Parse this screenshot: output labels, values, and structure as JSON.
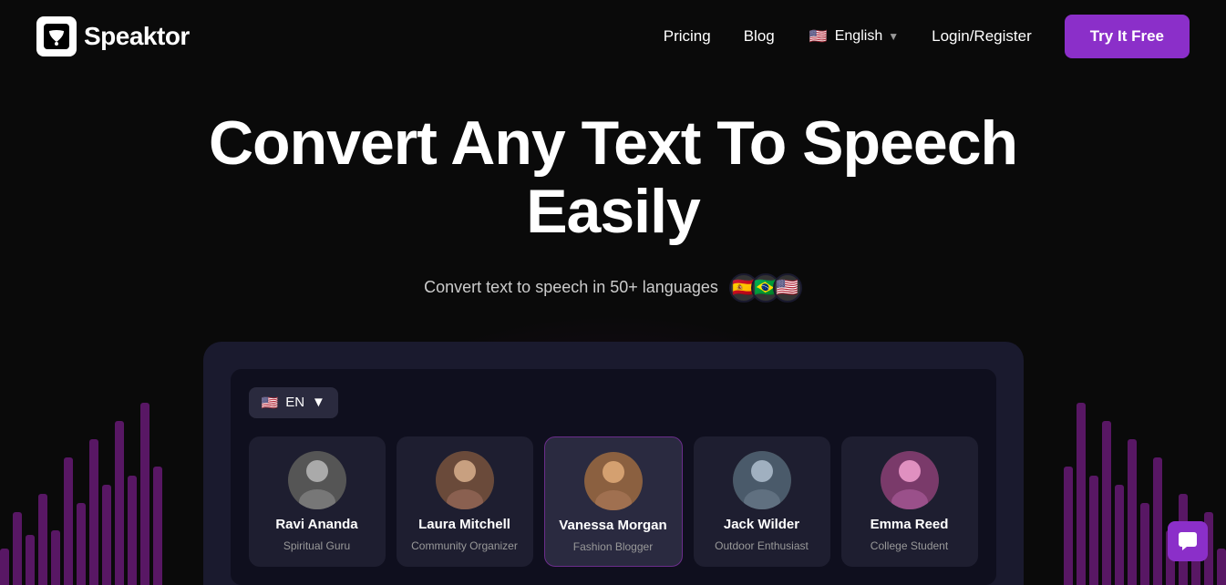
{
  "logo": {
    "text": "Speaktor"
  },
  "navbar": {
    "pricing": "Pricing",
    "blog": "Blog",
    "language": "English",
    "login": "Login/Register",
    "try_btn": "Try It Free"
  },
  "hero": {
    "title": "Convert Any Text To Speech Easily",
    "subtitle": "Convert text to speech in 50+ languages"
  },
  "demo": {
    "lang_code": "EN",
    "lang_flag": "🇺🇸"
  },
  "voices": [
    {
      "name": "Ravi Ananda",
      "role": "Spiritual Guru",
      "emoji": "👴"
    },
    {
      "name": "Laura Mitchell",
      "role": "Community Organizer",
      "emoji": "👩"
    },
    {
      "name": "Vanessa Morgan",
      "role": "Fashion Blogger",
      "emoji": "👩‍🦱"
    },
    {
      "name": "Jack Wilder",
      "role": "Outdoor Enthusiast",
      "emoji": "👨"
    },
    {
      "name": "Emma Reed",
      "role": "College Student",
      "emoji": "👩‍🦰"
    }
  ],
  "chat_icon": "💬",
  "flags": [
    "🇪🇸",
    "🇧🇷",
    "🇺🇸"
  ]
}
